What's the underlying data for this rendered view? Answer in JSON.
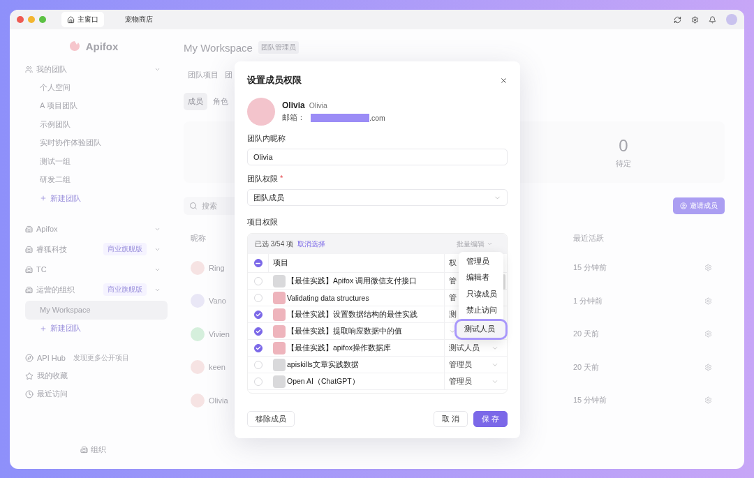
{
  "titlebar": {
    "tabs": [
      {
        "label": "主窗口",
        "selected": true
      },
      {
        "label": "宠物商店",
        "selected": false
      }
    ]
  },
  "sidebar": {
    "logo": "Apifox",
    "team_group": {
      "label": "我的团队",
      "items": [
        "个人空间",
        "A 项目团队",
        "示例团队",
        "实时协作体验团队",
        "测试一组",
        "研发二组"
      ],
      "add": "新建团队"
    },
    "orgs": [
      {
        "label": "Apifox"
      },
      {
        "label": "睿狐科技",
        "badge": "商业旗舰版"
      },
      {
        "label": "TC"
      },
      {
        "label": "运营的组织",
        "badge": "商业旗舰版",
        "children": [
          {
            "label": "My Workspace",
            "selected": true
          }
        ],
        "add": "新建团队"
      }
    ],
    "links": [
      {
        "kind": "hub",
        "label": "API Hub",
        "hint": "发现更多公开项目"
      },
      {
        "kind": "star",
        "label": "我的收藏"
      },
      {
        "kind": "clock",
        "label": "最近访问"
      }
    ],
    "footer": "组织"
  },
  "workspace": {
    "title": "My Workspace",
    "role_badge": "团队管理员",
    "tabs": [
      "团队项目",
      "团"
    ],
    "subtabs": [
      {
        "label": "成员",
        "selected": true
      },
      {
        "label": "角色",
        "selected": false
      }
    ],
    "stat": {
      "value": "0",
      "label": "待定"
    },
    "search": {
      "placeholder": "搜索"
    },
    "invite_button": "邀请成员",
    "columns": [
      "昵称",
      "最近活跃"
    ],
    "members": [
      {
        "name": "Ring",
        "last_active": "15 分钟前",
        "color": "#f6e3e3"
      },
      {
        "name": "Vano",
        "last_active": "1 分钟前",
        "color": "#e9e7f6"
      },
      {
        "name": "Vivien",
        "last_active": "20 天前",
        "color": "#d5efdc"
      },
      {
        "name": "keen",
        "last_active": "20 天前",
        "color": "#f6e3e3"
      },
      {
        "name": "Olivia",
        "last_active": "15 分钟前",
        "color": "#f6e3e3"
      }
    ]
  },
  "dialog": {
    "title": "设置成员权限",
    "user": {
      "name": "Olivia",
      "nickname": "Olivia",
      "email_label": "邮箱：",
      "email_redacted": true,
      "email_suffix": ".com"
    },
    "nickname_field": {
      "label": "团队内昵称",
      "value": "Olivia"
    },
    "team_role_field": {
      "label": "团队权限",
      "required_mark": "*",
      "value": "团队成员"
    },
    "projects": {
      "label": "项目权限",
      "selected_count": "已选 3/54 项",
      "clear": "取消选择",
      "bulk_edit": "批量编辑",
      "header": {
        "indeterminate": true,
        "name": "项目",
        "role": "权"
      },
      "rows": [
        {
          "checked": false,
          "color": "#d9d9db",
          "name": "【最佳实践】Apifox 调用微信支付接口",
          "role": "管"
        },
        {
          "checked": false,
          "color": "#eeb4bc",
          "name": "Validating data structures",
          "role": "管"
        },
        {
          "checked": true,
          "color": "#eeb4bc",
          "name": "【最佳实践】设置数据结构的最佳实践",
          "role": "测"
        },
        {
          "checked": true,
          "color": "#eeb4bc",
          "name": "【最佳实践】提取响应数据中的值"
        },
        {
          "checked": true,
          "color": "#eeb4bc",
          "name": "【最佳实践】apifox操作数据库",
          "role": "测试人员"
        },
        {
          "checked": false,
          "color": "#d9d9db",
          "name": "apiskills文章实践数据",
          "role": "管理员"
        },
        {
          "checked": false,
          "color": "#d9d9db",
          "name": "Open AI（ChatGPT）",
          "role": "管理员"
        }
      ],
      "menu": [
        {
          "label": "管理员",
          "selected": false
        },
        {
          "label": "编辑者",
          "selected": false
        },
        {
          "label": "只读成员",
          "selected": false
        },
        {
          "label": "禁止访问",
          "selected": false
        },
        {
          "label": "测试人员",
          "selected": true
        }
      ]
    },
    "buttons": {
      "remove": "移除成员",
      "cancel": "取 消",
      "save": "保 存"
    }
  }
}
